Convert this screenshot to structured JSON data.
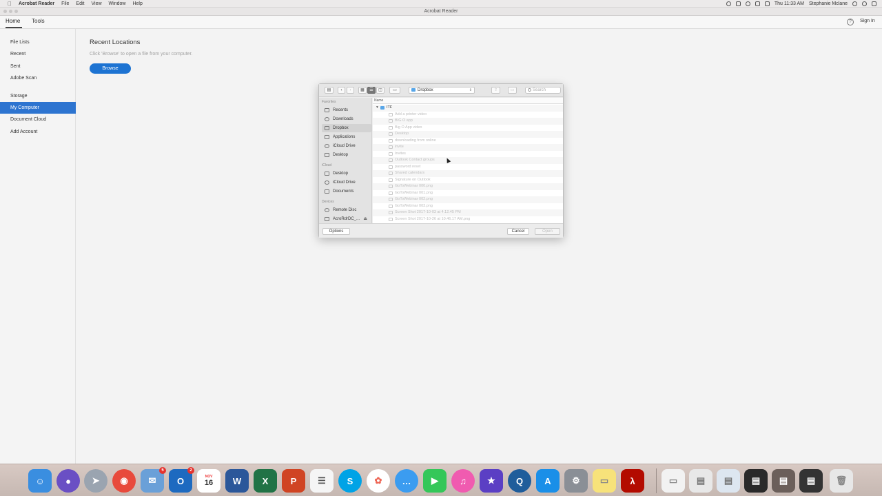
{
  "menubar": {
    "app_name": "Acrobat Reader",
    "menus": [
      "File",
      "Edit",
      "View",
      "Window",
      "Help"
    ],
    "clock": "Thu 11:33 AM",
    "user": "Stephanie Mclane"
  },
  "window": {
    "title": "Acrobat Reader"
  },
  "topbar": {
    "tabs": [
      "Home",
      "Tools"
    ],
    "help_icon": "?",
    "sign_in": "Sign In"
  },
  "sidebar": {
    "items": [
      {
        "label": "File Lists"
      },
      {
        "label": "Recent"
      },
      {
        "label": "Sent"
      },
      {
        "label": "Adobe Scan"
      },
      {
        "label": "Storage"
      },
      {
        "label": "My Computer",
        "selected": true
      },
      {
        "label": "Document Cloud"
      },
      {
        "label": "Add Account"
      }
    ]
  },
  "main": {
    "title": "Recent Locations",
    "hint": "Click 'Browse' to open a file from your computer.",
    "browse_label": "Browse"
  },
  "dialog": {
    "location": "Dropbox",
    "search_placeholder": "Search",
    "favorites_header": "Favorites",
    "favorites": [
      "Recents",
      "Downloads",
      "Dropbox",
      "Applications",
      "iCloud Drive",
      "Desktop"
    ],
    "icloud_header": "iCloud",
    "icloud": [
      "Desktop",
      "iCloud Drive",
      "Documents"
    ],
    "devices_header": "Devices",
    "devices": [
      "Remote Disc",
      "AcroRdrDC_..."
    ],
    "column_name": "Name",
    "folder": "ITF",
    "files": [
      "Add a printer video",
      "BIG O app",
      "Big O App video",
      "Desktop",
      "downloading from online",
      "invite",
      "Invites",
      "Outlook Contact groups",
      "password reset",
      "Shared calendars",
      "Signature  on Outlook",
      "GoToWebinar 000.png",
      "GoToWebinar 001.png",
      "GoToWebinar 002.png",
      "GoToWebinar 003.png",
      "Screen Shot 2017-10-03 at 4.12.45 PM",
      "Screen Shot 2017-10-26 at 10.46.17 AM.png"
    ],
    "options_label": "Options",
    "cancel_label": "Cancel",
    "open_label": "Open"
  },
  "dock": {
    "calendar_month": "NOV",
    "calendar_day": "16",
    "mail_badge": "5",
    "outlook_badge": "2",
    "colors": {
      "accent": "#2d74d0",
      "browse": "#1d73d2"
    }
  }
}
